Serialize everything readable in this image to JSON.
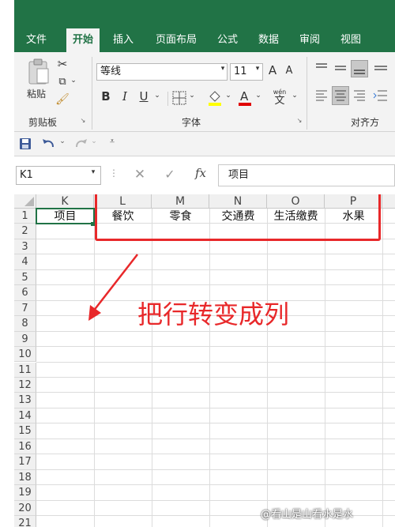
{
  "tabs": [
    "文件",
    "开始",
    "插入",
    "页面布局",
    "公式",
    "数据",
    "审阅",
    "视图"
  ],
  "ribbon": {
    "paste_label": "粘贴",
    "clipboard_label": "剪贴板",
    "font_name": "等线",
    "font_size": "11",
    "font_group_label": "字体",
    "align_group_label": "对齐方",
    "bold": "B",
    "italic": "I",
    "underline": "U",
    "grow_font": "A",
    "shrink_font": "A",
    "phonetic_top": "wén",
    "phonetic_bottom": "文"
  },
  "formula_bar": {
    "name_box": "K1",
    "fx": "fx",
    "content": "项目"
  },
  "sheet": {
    "columns": [
      "K",
      "L",
      "M",
      "N",
      "O",
      "P"
    ],
    "rows": [
      "1",
      "2",
      "3",
      "4",
      "5",
      "6",
      "7",
      "8",
      "9",
      "10",
      "11",
      "12",
      "13",
      "14",
      "15",
      "16",
      "17",
      "18",
      "19",
      "20",
      "21"
    ],
    "row1": [
      "项目",
      "餐饮",
      "零食",
      "交通费",
      "生活缴费",
      "水果"
    ]
  },
  "annotation": {
    "text": "把行转变成列",
    "color": "#e8282a"
  },
  "watermark": "@看山是山看水是水"
}
